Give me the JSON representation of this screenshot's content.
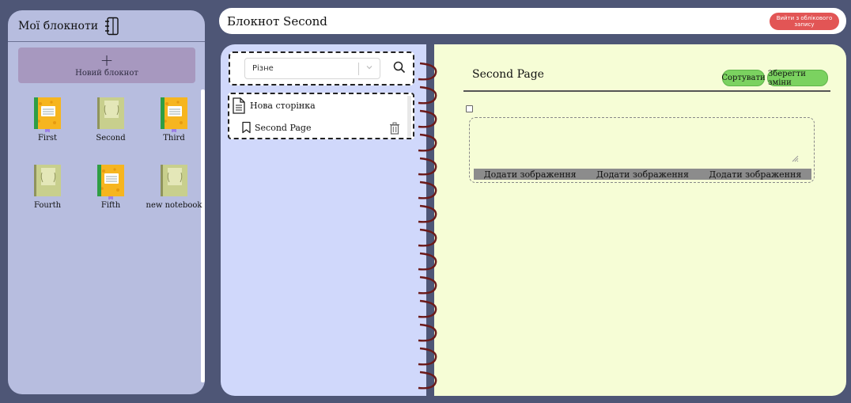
{
  "sidebar": {
    "title": "Мої блокноти",
    "new_notebook_plus": "+",
    "new_notebook_label": "Новий блокнот",
    "notebooks": [
      {
        "name": "First",
        "cover": "orange"
      },
      {
        "name": "Second",
        "cover": "beige"
      },
      {
        "name": "Third",
        "cover": "orange"
      },
      {
        "name": "Fourth",
        "cover": "beige"
      },
      {
        "name": "Fifth",
        "cover": "orange"
      },
      {
        "name": "new notebook",
        "cover": "beige"
      }
    ]
  },
  "topbar": {
    "title": "Блокнот Second",
    "logout_label": "Вийти з облікового запису"
  },
  "pages_panel": {
    "category_selected": "Різне",
    "new_page_label": "Нова сторінка",
    "pages": [
      {
        "title": "Second Page"
      }
    ]
  },
  "editor": {
    "page_title": "Second Page",
    "sort_label": "Сортувати",
    "save_label": "Зберегти зміни",
    "image_buttons": [
      "Додати зображення",
      "Додати зображення",
      "Додати зображення"
    ]
  },
  "colors": {
    "background": "#4e5676",
    "sidebar": "#b7bddf",
    "pages_panel": "#d0d8fb",
    "editor": "#f6fdd6",
    "button_green": "#7bd260",
    "logout_red": "#e25555",
    "new_notebook": "#a798bf"
  }
}
